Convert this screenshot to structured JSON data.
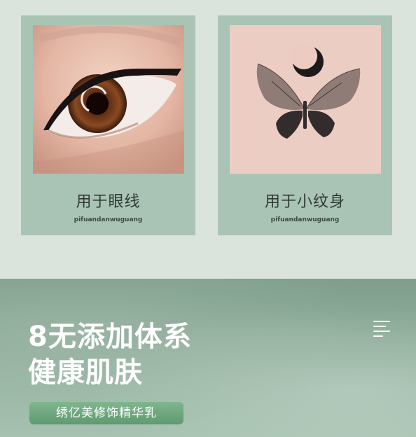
{
  "cards": [
    {
      "title": "用于眼线",
      "subtitle": "pifuandanwuguang"
    },
    {
      "title": "用于小纹身",
      "subtitle": "pifuandanwuguang"
    }
  ],
  "banner": {
    "headline_line1": "8无添加体系",
    "headline_line2": "健康肌肤",
    "product_label": "绣亿美修饰精华乳"
  },
  "icons": {
    "menu": "menu-icon"
  },
  "colors": {
    "card_bg": "#a9c4b5",
    "top_bg": "#dae4dd",
    "banner_bg": "#8aa895",
    "pill_bg": "#6aa57b"
  }
}
